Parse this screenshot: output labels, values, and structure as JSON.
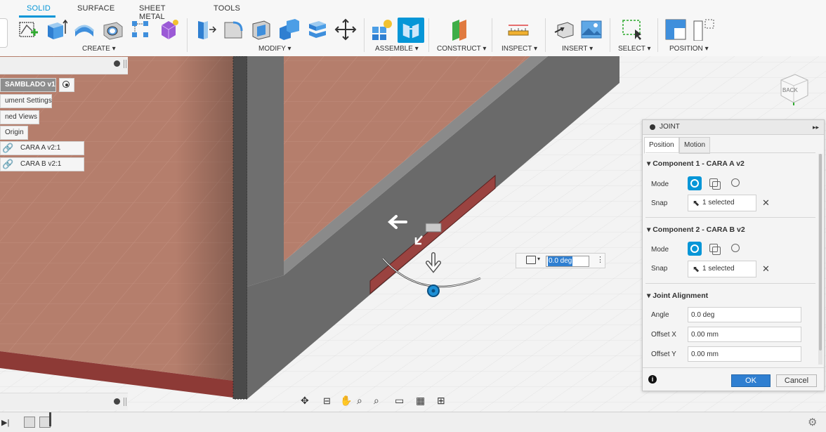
{
  "tabs": [
    "SOLID",
    "SURFACE",
    "SHEET METAL",
    "TOOLS"
  ],
  "groups": {
    "create": "CREATE",
    "modify": "MODIFY",
    "assemble": "ASSEMBLE",
    "construct": "CONSTRUCT",
    "inspect": "INSPECT",
    "insert": "INSERT",
    "select": "SELECT",
    "position": "POSITION"
  },
  "browser": {
    "root": "SAMBLADO v1",
    "items": [
      "ument Settings",
      "ned Views",
      "Origin",
      "CARA A v2:1",
      "CARA B v2:1"
    ]
  },
  "viewcube": {
    "face": "BACK"
  },
  "angle_manipulator": {
    "value": "0.0 deg"
  },
  "joint_panel": {
    "title": "JOINT",
    "tabs": [
      "Position",
      "Motion"
    ],
    "component1": {
      "title": "Component 1 - CARA A v2",
      "mode_label": "Mode",
      "snap_label": "Snap",
      "snap_value": "1 selected"
    },
    "component2": {
      "title": "Component 2 - CARA B v2",
      "mode_label": "Mode",
      "snap_label": "Snap",
      "snap_value": "1 selected"
    },
    "alignment": {
      "title": "Joint Alignment",
      "angle_label": "Angle",
      "angle_value": "0.0 deg",
      "offset_x_label": "Offset X",
      "offset_x_value": "0.00 mm",
      "offset_y_label": "Offset Y",
      "offset_y_value": "0.00 mm"
    },
    "ok": "OK",
    "cancel": "Cancel"
  },
  "colors": {
    "accent": "#0696d7",
    "wood": "#b27a68",
    "wall_gray": "#6e6e6e",
    "floor_red": "#8d3a36",
    "panel_bg": "#f4f4f4"
  },
  "icons": {
    "create": [
      "sketch-icon",
      "extrude-icon",
      "revolve-icon",
      "hole-icon",
      "pattern-icon",
      "form-icon"
    ],
    "modify": [
      "press-pull-icon",
      "fillet-icon",
      "shell-icon",
      "combine-icon",
      "align-icon",
      "move-icon"
    ],
    "assemble": [
      "new-component-icon",
      "joint-icon"
    ],
    "navigation": [
      "orbit-icon",
      "look-at-icon",
      "pan-icon",
      "zoom-icon",
      "zoom-window-icon",
      "display-icon",
      "grid-icon",
      "viewports-icon"
    ]
  }
}
